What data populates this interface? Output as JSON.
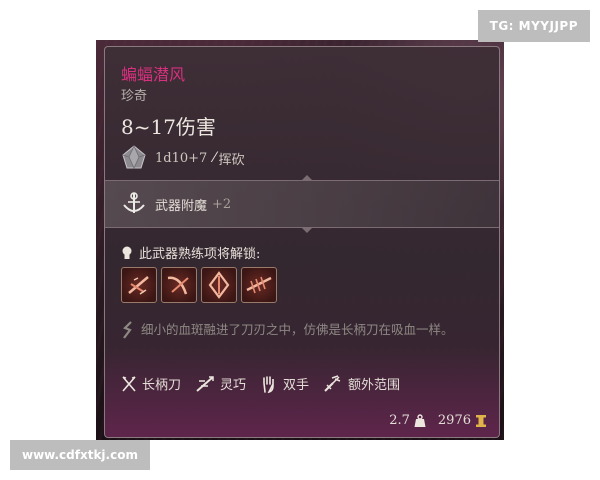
{
  "watermarks": {
    "top_right": "TG: MYYJJPP",
    "bottom_left": "www.cdfxtkj.com"
  },
  "item": {
    "name": "蝙蝠潜风",
    "rarity": "珍奇",
    "damage": "8~17伤害",
    "dice": "1d10+7",
    "damage_type": "挥砍",
    "name_color": "#d6307e"
  },
  "enchant": {
    "label": "武器附魔",
    "value": "+2"
  },
  "mastery": {
    "label": "此武器熟练项将解锁:",
    "actions": [
      {
        "icon": "slash-action-icon"
      },
      {
        "icon": "lacerate-action-icon"
      },
      {
        "icon": "pommel-strike-icon"
      },
      {
        "icon": "cleave-action-icon"
      }
    ]
  },
  "flavor": {
    "text": "细小的血斑融进了刀刃之中，仿佛是长柄刀在吸血一样。"
  },
  "properties": [
    {
      "label": "长柄刀",
      "icon": "glaive-icon"
    },
    {
      "label": "灵巧",
      "icon": "finesse-icon"
    },
    {
      "label": "双手",
      "icon": "two-handed-icon"
    },
    {
      "label": "额外范围",
      "icon": "reach-icon"
    }
  ],
  "footer": {
    "weight": "2.7",
    "value": "2976"
  }
}
